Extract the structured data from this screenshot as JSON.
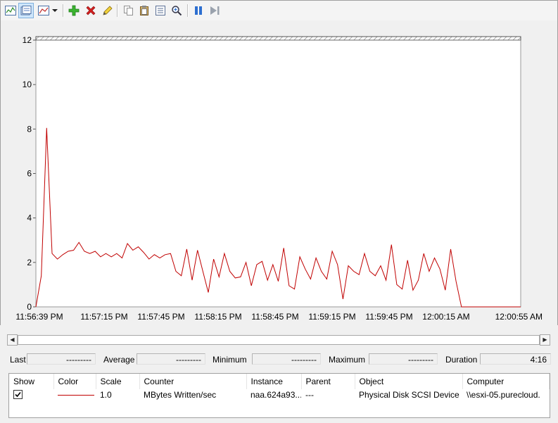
{
  "toolbar": {
    "buttons": [
      {
        "name": "view-current-activity-icon",
        "active": false
      },
      {
        "name": "view-log-data-icon",
        "active": true
      },
      {
        "name": "change-graph-type-icon",
        "active": false
      },
      {
        "name": "add-counter-icon"
      },
      {
        "name": "delete-counter-icon"
      },
      {
        "name": "highlight-icon"
      },
      {
        "name": "copy-properties-icon"
      },
      {
        "name": "paste-counter-list-icon"
      },
      {
        "name": "properties-icon"
      },
      {
        "name": "zoom-icon"
      },
      {
        "name": "freeze-display-icon"
      },
      {
        "name": "update-data-icon"
      }
    ]
  },
  "chart_data": {
    "type": "line",
    "title": "",
    "xlabel": "",
    "ylabel": "",
    "ylim": [
      0,
      12
    ],
    "yticks": [
      "0",
      "2",
      "4",
      "6",
      "8",
      "10",
      "12"
    ],
    "xticks": [
      "11:56:39 PM",
      "11:57:15 PM",
      "11:57:45 PM",
      "11:58:15 PM",
      "11:58:45 PM",
      "11:59:15 PM",
      "11:59:45 PM",
      "12:00:15 AM",
      "12:00:55 AM"
    ],
    "grid": false,
    "series": [
      {
        "color": "#c00000",
        "values": [
          0,
          1.4,
          8.05,
          2.4,
          2.15,
          2.35,
          2.5,
          2.55,
          2.9,
          2.5,
          2.4,
          2.5,
          2.25,
          2.4,
          2.25,
          2.4,
          2.2,
          2.85,
          2.55,
          2.7,
          2.45,
          2.15,
          2.35,
          2.2,
          2.35,
          2.4,
          1.6,
          1.4,
          2.6,
          1.2,
          2.55,
          1.6,
          0.65,
          2.15,
          1.35,
          2.4,
          1.6,
          1.3,
          1.35,
          2.0,
          0.95,
          1.9,
          2.05,
          1.2,
          1.9,
          1.15,
          2.65,
          0.95,
          0.8,
          2.25,
          1.7,
          1.25,
          2.2,
          1.6,
          1.25,
          2.5,
          1.9,
          0.35,
          1.85,
          1.6,
          1.45,
          2.4,
          1.6,
          1.4,
          1.85,
          1.2,
          2.8,
          1.0,
          0.8,
          2.1,
          0.75,
          1.2,
          2.4,
          1.6,
          2.2,
          1.7,
          0.75,
          2.6,
          1.15,
          0,
          0,
          0,
          0,
          0,
          0,
          0,
          0,
          0,
          0,
          0,
          0
        ]
      }
    ]
  },
  "scrollbar": {
    "left": "◀",
    "right": "▶"
  },
  "stats": {
    "last_label": "Last",
    "last_value": "---------",
    "average_label": "Average",
    "average_value": "---------",
    "minimum_label": "Minimum",
    "minimum_value": "---------",
    "maximum_label": "Maximum",
    "maximum_value": "---------",
    "duration_label": "Duration",
    "duration_value": "4:16"
  },
  "legend": {
    "headers": [
      "Show",
      "Color",
      "Scale",
      "Counter",
      "Instance",
      "Parent",
      "Object",
      "Computer"
    ],
    "rows": [
      {
        "show": true,
        "color": "#c00000",
        "scale": "1.0",
        "counter": "MBytes Written/sec",
        "instance": "naa.624a93...",
        "parent": "---",
        "object": "Physical Disk SCSI Device",
        "computer": "\\\\esxi-05.purecloud."
      }
    ]
  }
}
